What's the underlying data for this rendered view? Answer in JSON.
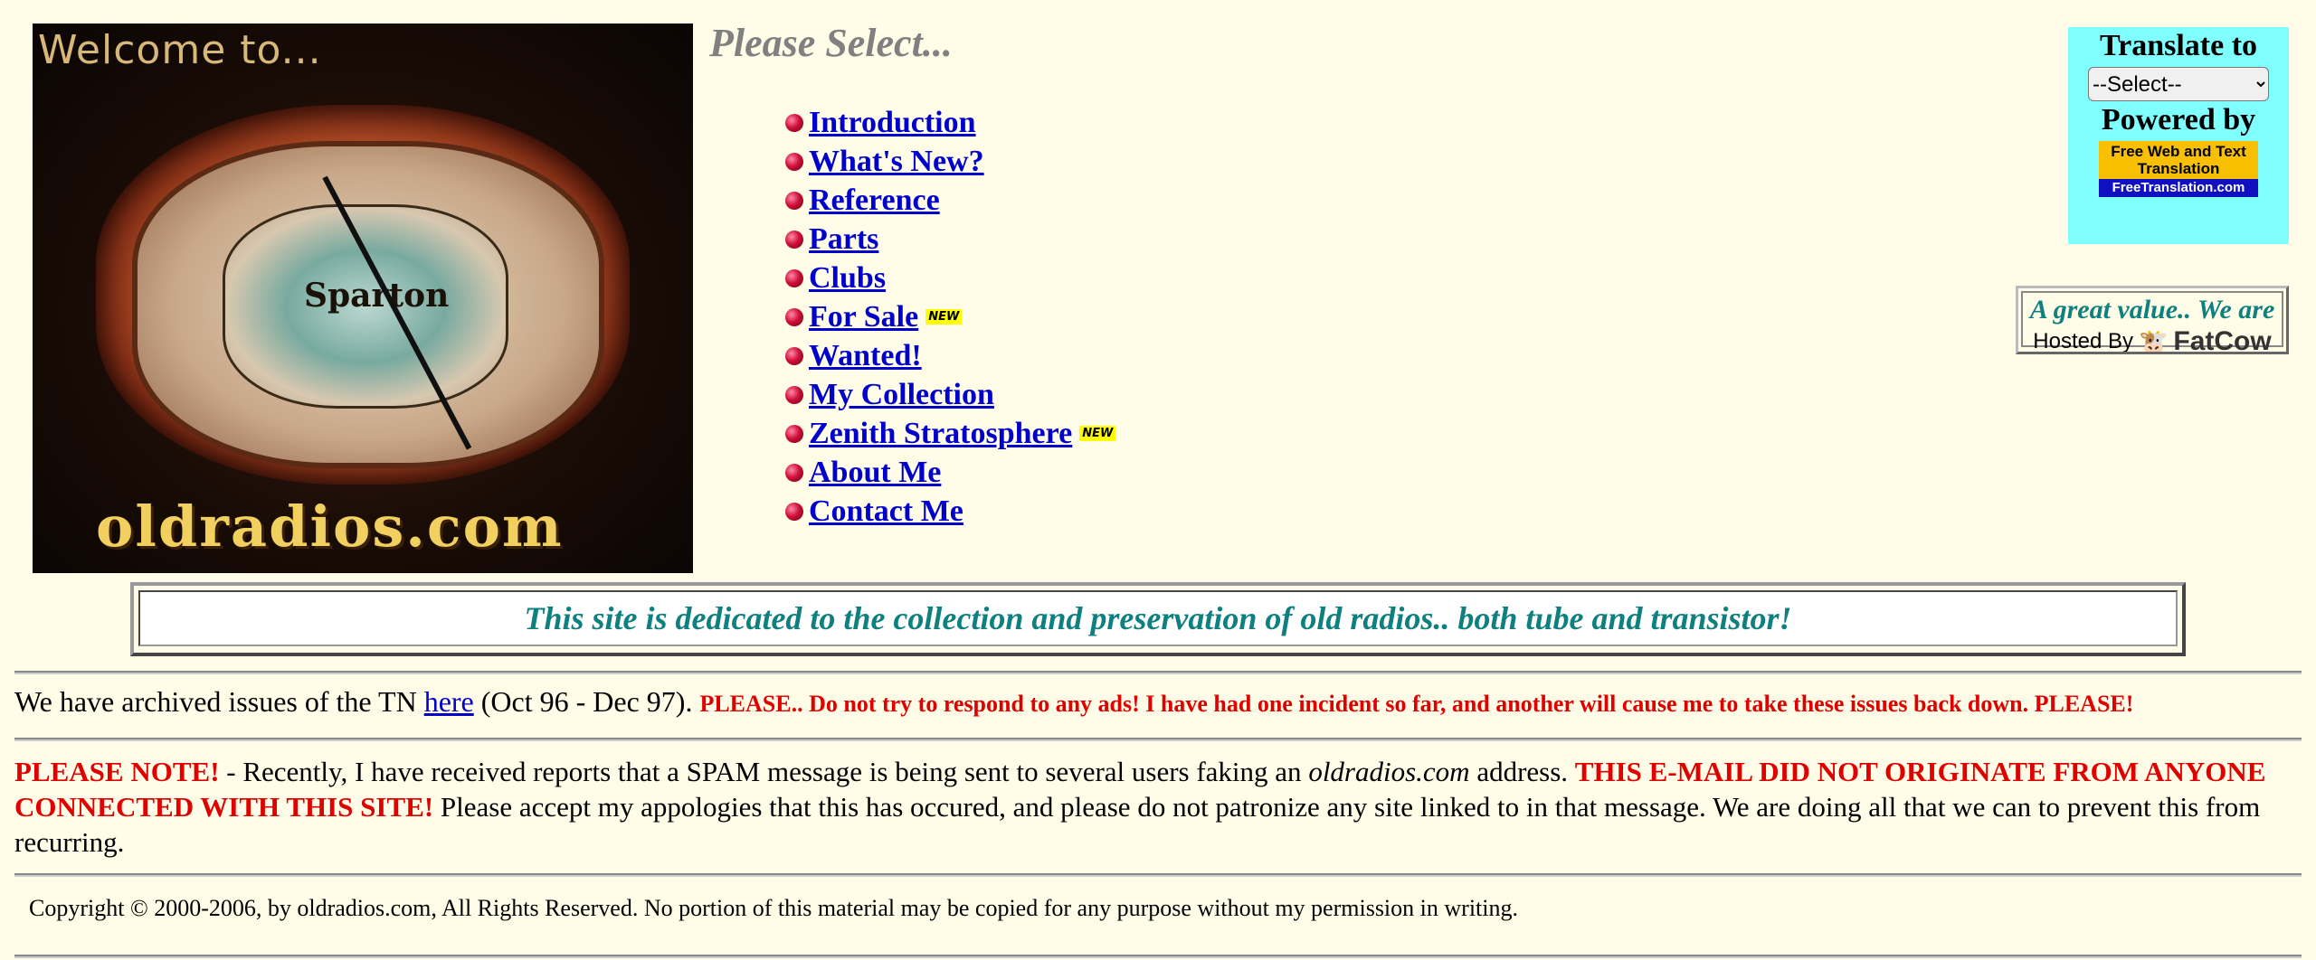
{
  "logo": {
    "welcome_text": "Welcome to...",
    "brand_text": "Sparton",
    "site_text": "oldradios.com"
  },
  "nav": {
    "heading": "Please Select...",
    "items": [
      {
        "label": "Introduction",
        "new": ""
      },
      {
        "label": "What's New?",
        "new": ""
      },
      {
        "label": "Reference",
        "new": ""
      },
      {
        "label": "Parts",
        "new": ""
      },
      {
        "label": "Clubs",
        "new": ""
      },
      {
        "label": "For Sale",
        "new": "NEW"
      },
      {
        "label": "Wanted!",
        "new": ""
      },
      {
        "label": "My Collection",
        "new": ""
      },
      {
        "label": "Zenith Stratosphere",
        "new": "NEW"
      },
      {
        "label": "About Me",
        "new": ""
      },
      {
        "label": "Contact Me",
        "new": ""
      }
    ]
  },
  "translate": {
    "title": "Translate to",
    "select_value": "--Select--",
    "powered_by": "Powered by",
    "badge_top": "Free Web and Text Translation",
    "badge_bottom": "FreeTranslation.com"
  },
  "hosted": {
    "message": "A great value.. We are",
    "hosted_by": "Hosted By",
    "host_name": "FatCow"
  },
  "banner": {
    "text": "This site is dedicated to the collection and preservation of old radios..  both tube and transistor!"
  },
  "archive": {
    "prefix": "We have archived issues of the TN ",
    "link": "here",
    "suffix": " (Oct 96 - Dec 97). ",
    "warning": "PLEASE.. Do not try to respond to any ads! I have had one incident so far, and another will cause me to take these issues back down. PLEASE!"
  },
  "note": {
    "label": "PLEASE NOTE!",
    "text1": " - Recently, I have received reports that a SPAM message is being sent to several users faking an ",
    "domain": "oldradios.com",
    "text2": " address. ",
    "alert": "THIS E-MAIL DID NOT ORIGINATE FROM ANYONE CONNECTED WITH THIS SITE!",
    "text3": " Please accept my appologies that this has occured, and please do not patronize any site linked to in that message. We are doing all that we can to prevent this from recurring."
  },
  "copyright": "Copyright © 2000-2006, by oldradios.com, All Rights Reserved. No portion of this material may be copied for any purpose without my permission in writing.",
  "colors": {
    "background": "#fffde8",
    "link": "#0000cc",
    "teal": "#0e8080",
    "alert_red": "#e00000",
    "translate_bg": "#80ffff"
  }
}
